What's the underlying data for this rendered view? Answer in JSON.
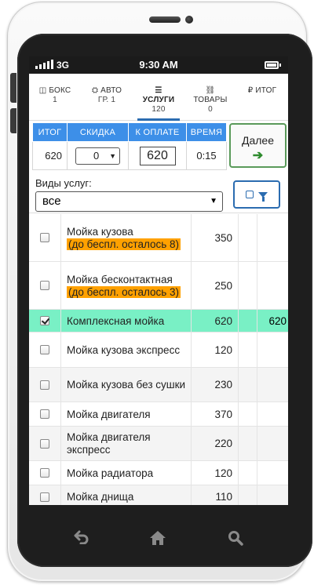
{
  "status": {
    "network": "3G",
    "time": "9:30 AM"
  },
  "tabs": [
    {
      "icon": "box-icon",
      "glyph": "◫",
      "label": "БОКС",
      "sub": "1"
    },
    {
      "icon": "car-icon",
      "glyph": "🚗",
      "label": "АВТО",
      "sub": "ГР. 1"
    },
    {
      "icon": "list-icon",
      "glyph": "☰",
      "label": "УСЛУГИ",
      "sub": "120"
    },
    {
      "icon": "basket-icon",
      "glyph": "🛒",
      "label": "ТОВАРЫ",
      "sub": "0"
    },
    {
      "icon": "ruble-icon",
      "glyph": "₽",
      "label": "ИТОГ",
      "sub": ""
    }
  ],
  "summary": {
    "headers": {
      "total": "ИТОГ",
      "discount": "СКИДКА",
      "to_pay": "К ОПЛАТЕ",
      "time": "ВРЕМЯ"
    },
    "total": "620",
    "discount": "0",
    "to_pay": "620",
    "time": "0:15"
  },
  "next_button": {
    "label": "Далее",
    "arrow": "➔"
  },
  "filter": {
    "label": "Виды услуг:",
    "value": "все"
  },
  "services": [
    {
      "name": "Мойка кузова",
      "note": "(до беспл. осталось 8)",
      "price": "350",
      "sum": "",
      "checked": false
    },
    {
      "name": "Мойка бесконтактная",
      "note": "(до беспл. осталось 3)",
      "price": "250",
      "sum": "",
      "checked": false
    },
    {
      "name": "Комплексная мойка",
      "note": "",
      "price": "620",
      "sum": "620",
      "checked": true
    },
    {
      "name": "Мойка кузова экспресс",
      "note": "",
      "price": "120",
      "sum": "",
      "checked": false
    },
    {
      "name": "Мойка кузова без сушки",
      "note": "",
      "price": "230",
      "sum": "",
      "checked": false
    },
    {
      "name": "Мойка двигателя",
      "note": "",
      "price": "370",
      "sum": "",
      "checked": false
    },
    {
      "name": "Мойка двигателя экспресс",
      "note": "",
      "price": "220",
      "sum": "",
      "checked": false
    },
    {
      "name": "Мойка радиатора",
      "note": "",
      "price": "120",
      "sum": "",
      "checked": false
    },
    {
      "name": "Мойка днища",
      "note": "",
      "price": "110",
      "sum": "",
      "checked": false
    }
  ],
  "colors": {
    "header_blue": "#3d8fe8",
    "selected_row": "#79f0c5",
    "highlight": "#ffa100",
    "next_green": "#5a9a5a"
  }
}
